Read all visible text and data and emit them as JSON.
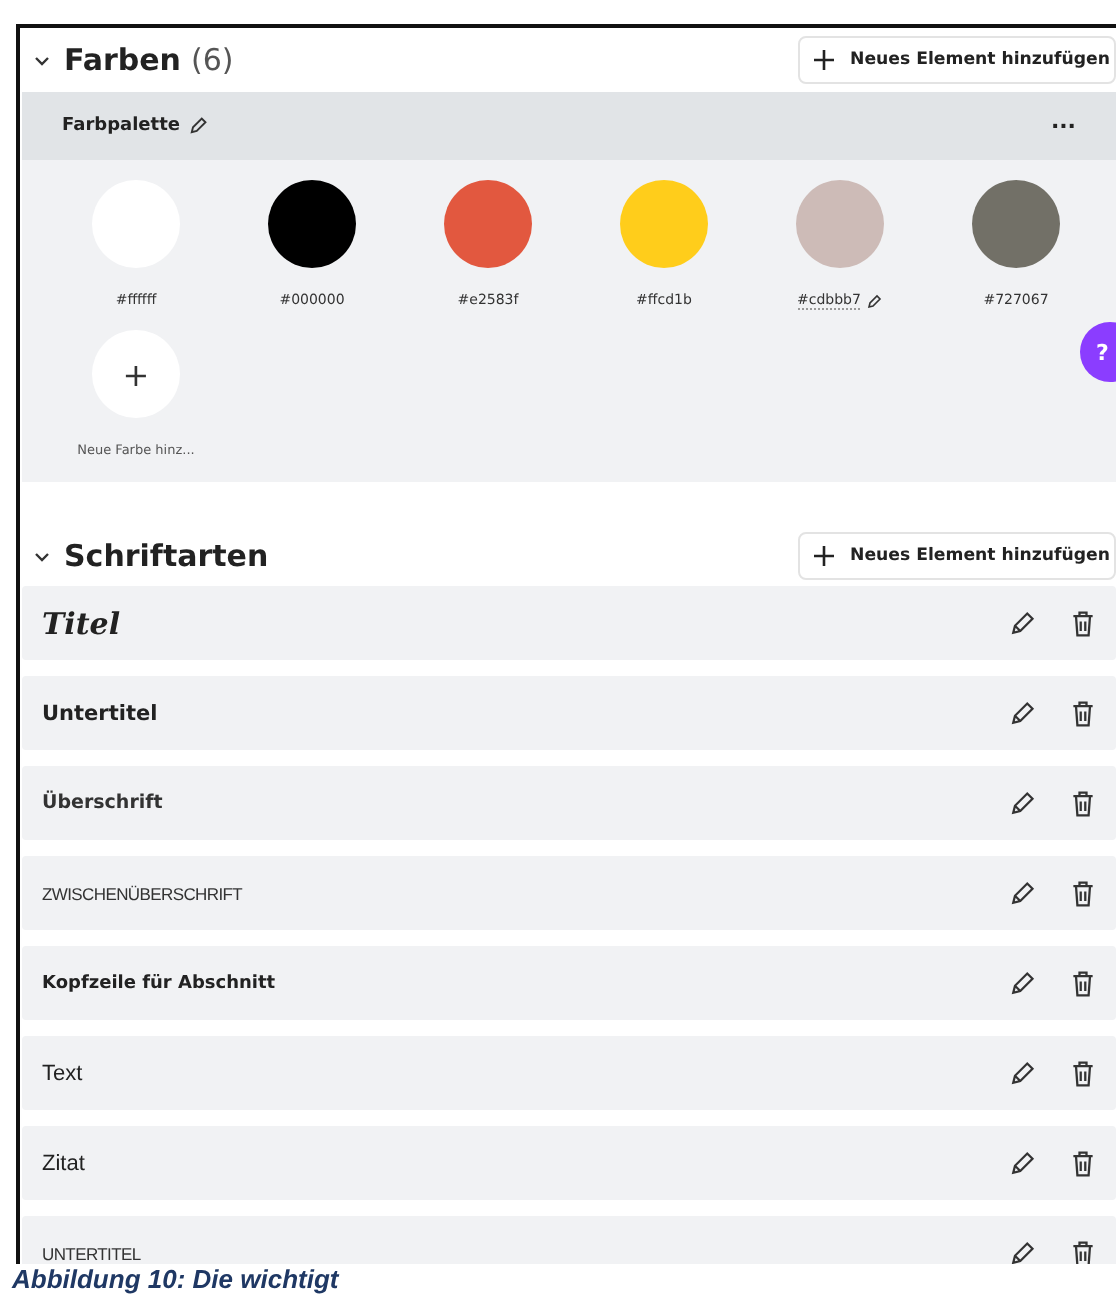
{
  "colors_section": {
    "title": "Farben",
    "count": "(6)",
    "expanded": true,
    "add_button": "Neues Element hinzufügen",
    "palette": {
      "name": "Farbpalette",
      "more": "...",
      "swatches": [
        {
          "label": "#ffffff",
          "color": "#ffffff",
          "hovered": false
        },
        {
          "label": "#000000",
          "color": "#000000",
          "hovered": false
        },
        {
          "label": "#e2583f",
          "color": "#e2583f",
          "hovered": false
        },
        {
          "label": "#ffcd1b",
          "color": "#ffcd1b",
          "hovered": false
        },
        {
          "label": "#cdbbb7",
          "color": "#cdbbb7",
          "hovered": true
        },
        {
          "label": "#727067",
          "color": "#727067",
          "hovered": false
        }
      ],
      "add_color": {
        "symbol": "+",
        "label": "Neue Farbe hinz..."
      }
    }
  },
  "help_button": {
    "label": "?"
  },
  "fonts_section": {
    "title": "Schriftarten",
    "expanded": true,
    "add_button": "Neues Element hinzufügen",
    "fonts": [
      {
        "name": "Titel",
        "kind": "script"
      },
      {
        "name": "Untertitel",
        "kind": "semibold"
      },
      {
        "name": "Überschrift",
        "kind": "medium"
      },
      {
        "name": "ZWISCHENÜBERSCHRIFT",
        "kind": "condensed"
      },
      {
        "name": "Kopfzeile für Abschnitt",
        "kind": "bold"
      },
      {
        "name": "Text",
        "kind": "regular"
      },
      {
        "name": "Zitat",
        "kind": "regular"
      },
      {
        "name": "UNTERTITEL",
        "kind": "condensed"
      }
    ]
  },
  "caption": "Abbildung 10: Die wichtigt"
}
